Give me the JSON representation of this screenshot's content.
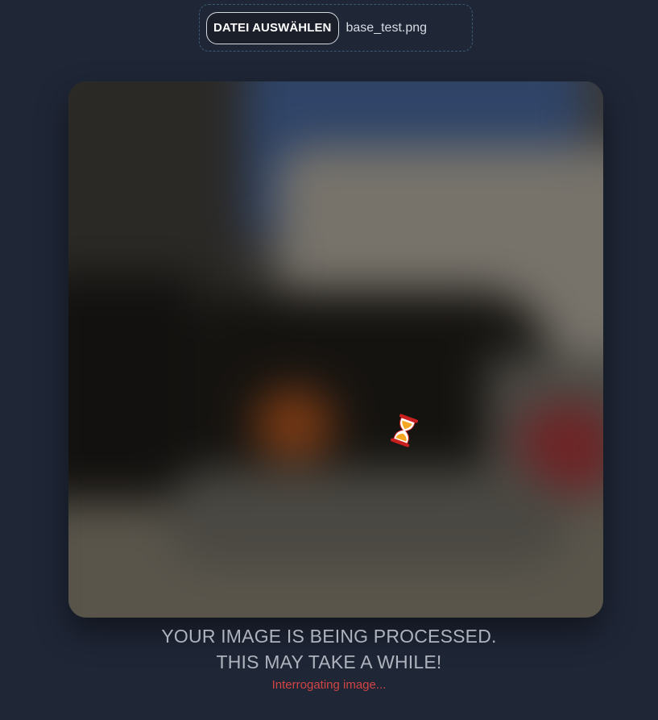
{
  "file_picker": {
    "button_label": "DATEI AUSWÄHLEN",
    "file_name": "base_test.png"
  },
  "preview": {
    "loading_icon": "hourglass-icon"
  },
  "status": {
    "line1": "YOUR IMAGE IS BEING PROCESSED.",
    "line2": "THIS MAY TAKE A WHILE!",
    "subtext": "Interrogating image..."
  }
}
